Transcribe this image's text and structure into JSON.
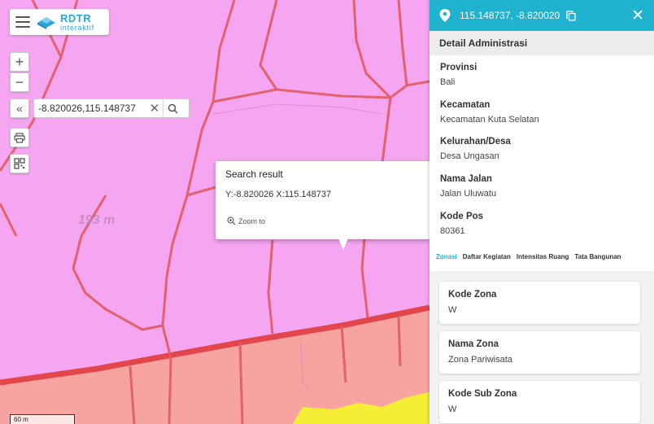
{
  "app": {
    "logo_title": "RDTR",
    "logo_subtitle": "interaktif"
  },
  "map": {
    "zoom_in": "+",
    "zoom_out": "−",
    "collapse": "«",
    "search_value": "-8.820026,115.148737",
    "distance_label": "193 m",
    "scale_label": "60 m",
    "colors": {
      "residential_zone": "#f6a6f1",
      "tourism_zone": "#f7a3a2",
      "road": "#e2464b",
      "yellow_zone": "#f5ee35"
    }
  },
  "popup": {
    "title": "Search result",
    "coords": "Y:-8.820026 X:115.148737",
    "zoom_to": "Zoom to"
  },
  "panel": {
    "header_coord": "115.148737, -8.820020",
    "section_title": "Detail Administrasi",
    "fields": [
      {
        "label": "Provinsi",
        "value": "Bali"
      },
      {
        "label": "Kecamatan",
        "value": "Kecamatan Kuta Selatan"
      },
      {
        "label": "Kelurahan/Desa",
        "value": "Desa Ungasan"
      },
      {
        "label": "Nama Jalan",
        "value": "Jalan Uluwatu"
      },
      {
        "label": "Kode Pos",
        "value": "80361"
      }
    ],
    "tabs": [
      "Zonasi",
      "Daftar Kegiatan",
      "Intensitas Ruang",
      "Tata Bangunan"
    ],
    "active_tab": "Zonasi",
    "cards": [
      {
        "label": "Kode Zona",
        "value": "W"
      },
      {
        "label": "Nama Zona",
        "value": "Zona Pariwisata"
      },
      {
        "label": "Kode Sub Zona",
        "value": "W"
      }
    ],
    "accent_color": "#20b3cf"
  }
}
